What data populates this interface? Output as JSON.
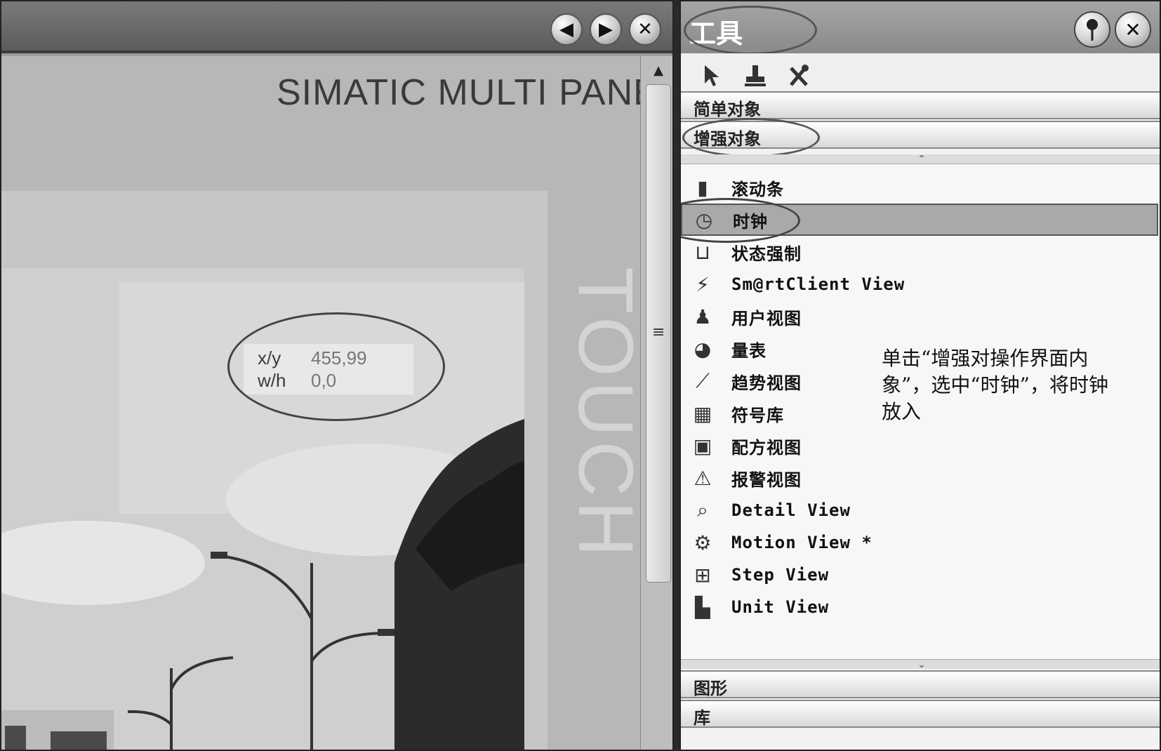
{
  "editor": {
    "nav_prev": "◀",
    "nav_next": "▶",
    "nav_close": "✕",
    "brand": "SIMATIC MULTI PANE",
    "touch_text": "TOUCH",
    "coords": {
      "xy_label": "x/y",
      "xy_value": "455,99",
      "wh_label": "w/h",
      "wh_value": "0,0"
    },
    "scroll_up": "▲",
    "scroll_grip": "≡"
  },
  "tools": {
    "title": "工具",
    "pin_icon": "📍",
    "close_icon": "✕",
    "toolbar": {
      "pointer_icon": "pointer-icon",
      "stamp_icon": "stamp-icon",
      "tools_icon": "tools-icon"
    },
    "sections": {
      "simple": "简单对象",
      "enhanced": "增强对象",
      "graphics": "图形",
      "library": "库"
    },
    "items": [
      {
        "label": "滚动条",
        "icon": "▮"
      },
      {
        "label": "时钟",
        "icon": "◷"
      },
      {
        "label": "状态强制",
        "icon": "⊔"
      },
      {
        "label": "Sm@rtClient View",
        "icon": "⚡"
      },
      {
        "label": "用户视图",
        "icon": "♟"
      },
      {
        "label": "量表",
        "icon": "◕"
      },
      {
        "label": "趋势视图",
        "icon": "⟋"
      },
      {
        "label": "符号库",
        "icon": "▦"
      },
      {
        "label": "配方视图",
        "icon": "▣"
      },
      {
        "label": "报警视图",
        "icon": "⚠"
      },
      {
        "label": "Detail View",
        "icon": "⌕"
      },
      {
        "label": "Motion View *",
        "icon": "⚙"
      },
      {
        "label": "Step View",
        "icon": "⊞"
      },
      {
        "label": "Unit View",
        "icon": "▙"
      }
    ],
    "selected_index": 1,
    "annotation": "单击“增强对操作界面内象”，选中“时钟”，将时钟放入",
    "sep_up": "⌃",
    "sep_down": "⌄"
  }
}
